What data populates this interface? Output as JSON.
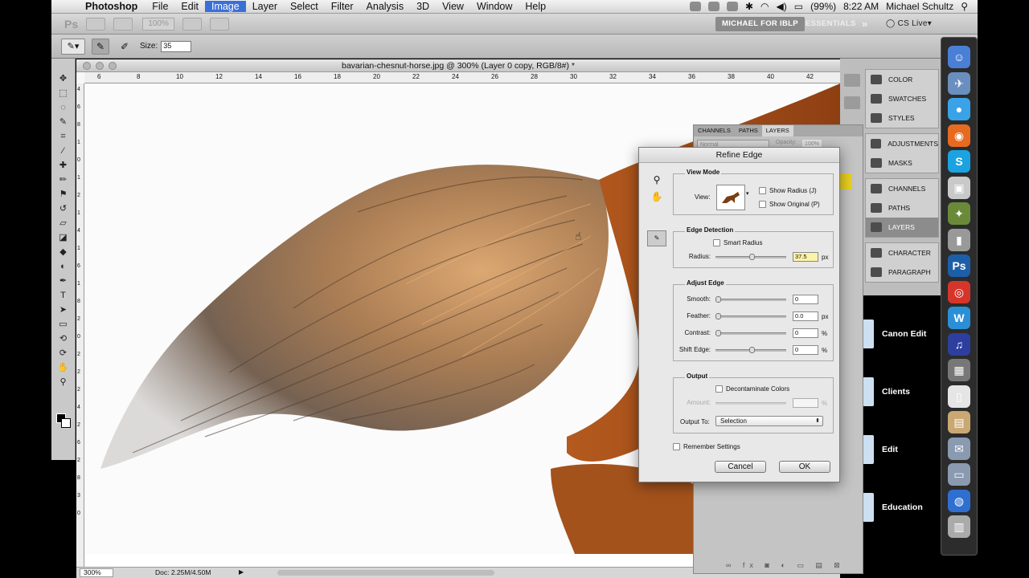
{
  "menubar": {
    "app_name": "Photoshop",
    "items": [
      "File",
      "Edit",
      "Image",
      "Layer",
      "Select",
      "Filter",
      "Analysis",
      "3D",
      "View",
      "Window",
      "Help"
    ],
    "active_item": "Image",
    "battery": "(99%)",
    "time": "8:22 AM",
    "user": "Michael Schultz"
  },
  "appbar": {
    "logo": "Ps",
    "zoom_level": "100%",
    "workspace_active": "MICHAEL FOR IBLP",
    "workspace_essentials": "ESSENTIALS",
    "workspace_more": "»",
    "cs_live": "CS Live"
  },
  "options_bar": {
    "size_label": "Size:",
    "size_value": "35"
  },
  "document": {
    "title": "bavarian-chesnut-horse.jpg @ 300% (Layer 0 copy, RGB/8#) *",
    "ruler_h": [
      "6",
      "8",
      "10",
      "12",
      "14",
      "16",
      "18",
      "20",
      "22",
      "24",
      "26",
      "28",
      "30",
      "32",
      "34",
      "36",
      "38",
      "40",
      "42"
    ],
    "ruler_v": [
      "4",
      "6",
      "8",
      "1",
      "0",
      "1",
      "2",
      "1",
      "4",
      "1",
      "6",
      "1",
      "8",
      "2",
      "0",
      "2",
      "2",
      "2",
      "4",
      "2",
      "6",
      "2",
      "8",
      "3",
      "0"
    ],
    "zoom": "300%",
    "doc_info": "Doc: 2.25M/4.50M"
  },
  "tools": [
    "move",
    "marquee",
    "lasso",
    "quick-select",
    "crop",
    "eyedropper",
    "healing",
    "brush",
    "clone-stamp",
    "history-brush",
    "eraser",
    "gradient",
    "blur",
    "dodge",
    "pen",
    "type",
    "path-select",
    "shape",
    "3d-rotate",
    "3d-orbit",
    "hand",
    "zoom"
  ],
  "panel_dock": {
    "groups": [
      [
        {
          "label": "COLOR",
          "icon": "color-icon"
        },
        {
          "label": "SWATCHES",
          "icon": "swatches-icon"
        },
        {
          "label": "STYLES",
          "icon": "styles-icon"
        }
      ],
      [
        {
          "label": "ADJUSTMENTS",
          "icon": "adjustments-icon"
        },
        {
          "label": "MASKS",
          "icon": "masks-icon"
        }
      ],
      [
        {
          "label": "CHANNELS",
          "icon": "channels-icon"
        },
        {
          "label": "PATHS",
          "icon": "paths-icon"
        },
        {
          "label": "LAYERS",
          "icon": "layers-icon",
          "active": true
        }
      ],
      [
        {
          "label": "CHARACTER",
          "icon": "character-icon"
        },
        {
          "label": "PARAGRAPH",
          "icon": "paragraph-icon"
        }
      ]
    ]
  },
  "layers_panel": {
    "tabs": [
      "CHANNELS",
      "PATHS",
      "LAYERS"
    ],
    "blend_mode": "Normal",
    "opacity_label": "Opacity:",
    "opacity": "100%"
  },
  "refine_edge": {
    "title": "Refine Edge",
    "view_mode": {
      "title": "View Mode",
      "view_label": "View:",
      "show_radius": "Show Radius (J)",
      "show_original": "Show Original (P)"
    },
    "edge_detection": {
      "title": "Edge Detection",
      "smart_radius": "Smart Radius",
      "radius_label": "Radius:",
      "radius_value": "37.5",
      "radius_unit": "px",
      "radius_level": 0.5
    },
    "adjust_edge": {
      "title": "Adjust Edge",
      "rows": [
        {
          "label": "Smooth:",
          "value": "0",
          "unit": "",
          "level": 0.0
        },
        {
          "label": "Feather:",
          "value": "0.0",
          "unit": "px",
          "level": 0.0
        },
        {
          "label": "Contrast:",
          "value": "0",
          "unit": "%",
          "level": 0.0
        },
        {
          "label": "Shift Edge:",
          "value": "0",
          "unit": "%",
          "level": 0.5
        }
      ]
    },
    "output": {
      "title": "Output",
      "decontaminate": "Decontaminate Colors",
      "amount_label": "Amount:",
      "amount_unit": "%",
      "output_to_label": "Output To:",
      "output_to_value": "Selection"
    },
    "remember": "Remember Settings",
    "cancel": "Cancel",
    "ok": "OK"
  },
  "desktop": {
    "folders": [
      "Canon Edit",
      "Clients",
      "Edit",
      "Education"
    ]
  },
  "mac_dock": {
    "apps": [
      {
        "name": "finder-icon",
        "glyph": "☺",
        "color": "#4a7fd6"
      },
      {
        "name": "preview-icon",
        "glyph": "✈",
        "color": "#6a8fbf"
      },
      {
        "name": "ichat-icon",
        "glyph": "●",
        "color": "#3aa3e8"
      },
      {
        "name": "firefox-icon",
        "glyph": "◉",
        "color": "#e66a1f"
      },
      {
        "name": "skype-icon",
        "glyph": "S",
        "color": "#1aa3e0"
      },
      {
        "name": "boxes-icon",
        "glyph": "▣",
        "color": "#c9c9c9"
      },
      {
        "name": "bridge-icon",
        "glyph": "✦",
        "color": "#6a8a3a"
      },
      {
        "name": "camera-icon",
        "glyph": "▮",
        "color": "#999999"
      },
      {
        "name": "photoshop-icon",
        "glyph": "Ps",
        "color": "#1c5fa8"
      },
      {
        "name": "chrome-icon",
        "glyph": "◎",
        "color": "#d6352a"
      },
      {
        "name": "word-icon",
        "glyph": "W",
        "color": "#2b8fd8"
      },
      {
        "name": "itunes-icon",
        "glyph": "♫",
        "color": "#2e3e9e"
      },
      {
        "name": "video-icon",
        "glyph": "▦",
        "color": "#777777"
      },
      {
        "name": "document-icon",
        "glyph": "▯",
        "color": "#e5e5e5"
      },
      {
        "name": "archive-icon",
        "glyph": "▤",
        "color": "#c9a873"
      },
      {
        "name": "mail-icon",
        "glyph": "✉",
        "color": "#8a9ab0"
      },
      {
        "name": "network-icon",
        "glyph": "▭",
        "color": "#8a9ab0"
      },
      {
        "name": "globe-icon",
        "glyph": "◍",
        "color": "#2f6fd0"
      },
      {
        "name": "trash-icon",
        "glyph": "▥",
        "color": "#aaaaaa"
      }
    ]
  }
}
